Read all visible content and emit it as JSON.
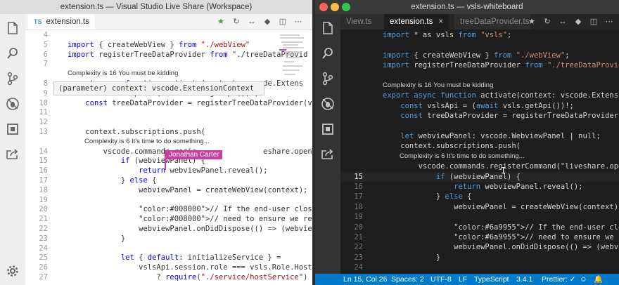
{
  "left": {
    "title": "extension.ts — Visual Studio Live Share (Workspace)",
    "tab": {
      "badge": "TS",
      "label": "extension.ts"
    },
    "hover_text": "(parameter) context: vscode.ExtensionContext",
    "participant": "Jonathan Carter",
    "lines": [
      {
        "n": "4",
        "t": ""
      },
      {
        "n": "5",
        "t": "import { createWebView } from \"./webView\""
      },
      {
        "n": "6",
        "t": "import registerTreeDataProvider from \"./treeDataProvid"
      },
      {
        "n": "7",
        "t": ""
      },
      {
        "n": "",
        "t": "Complexity is 16 You must be kidding",
        "lens": true
      },
      {
        "n": "8",
        "t": "export async function activate(context: vscode.Extens"
      },
      {
        "n": "9",
        "t": "    const vslsApi = (await vsls.getApi())!;"
      },
      {
        "n": "10",
        "t": "    const treeDataProvider = registerTreeDataProvider(v"
      },
      {
        "n": "11",
        "t": ""
      },
      {
        "n": "12",
        "t": ""
      },
      {
        "n": "13",
        "t": "    context.subscriptions.push("
      },
      {
        "n": "",
        "t": "Complexity is 6 It's time to do something...",
        "lens": true,
        "indent": true
      },
      {
        "n": "14",
        "t": "        vscode.commands.regis               eshare.openWhi"
      },
      {
        "n": "15",
        "t": "            if (webviewPanel) {"
      },
      {
        "n": "16",
        "t": "                return webviewPanel.reveal();"
      },
      {
        "n": "17",
        "t": "            } else {"
      },
      {
        "n": "18",
        "t": "                webviewPanel = createWebView(context);"
      },
      {
        "n": "19",
        "t": ""
      },
      {
        "n": "20",
        "t": "                // If the end-user closes the whiteboard, ther"
      },
      {
        "n": "21",
        "t": "                // need to ensure we re-created it on the next"
      },
      {
        "n": "22",
        "t": "                webviewPanel.onDidDispose(() => (webviewPanel"
      },
      {
        "n": "23",
        "t": "            }"
      },
      {
        "n": "24",
        "t": ""
      },
      {
        "n": "25",
        "t": "            let { default: initializeService } ="
      },
      {
        "n": "26",
        "t": "                vslsApi.session.role === vsls.Role.Host"
      },
      {
        "n": "27",
        "t": "                    ? require(\"./service/hostService\")"
      }
    ]
  },
  "right": {
    "title": "extension.ts — vsls-whiteboard",
    "tabs": [
      {
        "label": "View.ts",
        "active": false
      },
      {
        "label": "extension.ts",
        "active": true
      },
      {
        "label": "treeDataProvider.ts",
        "active": false
      }
    ],
    "lines": [
      {
        "n": "",
        "t": "import * as vsls from \"vsls\";"
      },
      {
        "n": "",
        "t": ""
      },
      {
        "n": "",
        "t": "import { createWebView } from \"./webView\";"
      },
      {
        "n": "",
        "t": "import registerTreeDataProvider from \"./treeDataProvider\""
      },
      {
        "n": "",
        "t": ""
      },
      {
        "n": "",
        "t": "Complexity is 16 You must be kidding",
        "lens": true
      },
      {
        "n": "",
        "t": "export async function activate(context: vscode.ExtensionCo"
      },
      {
        "n": "",
        "t": "    const vslsApi = (await vsls.getApi())!;"
      },
      {
        "n": "",
        "t": "    const treeDataProvider = registerTreeDataProvider(vslsApi"
      },
      {
        "n": "",
        "t": ""
      },
      {
        "n": "",
        "t": "    let webviewPanel: vscode.WebviewPanel | null;"
      },
      {
        "n": "",
        "t": "    context.subscriptions.push("
      },
      {
        "n": "",
        "t": "Complexity is 6 It's time to do something...",
        "lens": true,
        "indent": true
      },
      {
        "n": "",
        "t": "        vscode.commands.registerCommand(\"liveshare.openWhiteboa"
      },
      {
        "n": "15",
        "t": "            if (webviewPanel) {",
        "cur": true
      },
      {
        "n": "16",
        "t": "                return webviewPanel.reveal();"
      },
      {
        "n": "17",
        "t": "            } else {"
      },
      {
        "n": "18",
        "t": "                webviewPanel = createWebView(context);"
      },
      {
        "n": "19",
        "t": ""
      },
      {
        "n": "20",
        "t": "                // If the end-user closes the whiteboard, then we"
      },
      {
        "n": "21",
        "t": "                // need to ensure we re-created it on the next clic"
      },
      {
        "n": "22",
        "t": "                webviewPanel.onDidDispose(() => (webviewPanel = nul"
      },
      {
        "n": "23",
        "t": "            }"
      },
      {
        "n": "24",
        "t": ""
      },
      {
        "n": "25",
        "t": "            let { default: initializeService } ="
      }
    ],
    "status": {
      "position": "Ln 15, Col 26",
      "spaces": "Spaces: 2",
      "encoding": "UTF-8",
      "eol": "LF",
      "language": "TypeScript",
      "version": "3.4.1",
      "prettier": "Prettier: ✓"
    }
  },
  "colors": {
    "left_bg": "#ffffff",
    "right_bg": "#1e1e1e",
    "status_bar": "#007acc",
    "participant_flag": "#c93f9b"
  },
  "icons": [
    "files-icon",
    "search-icon",
    "source-control-icon",
    "debug-icon",
    "extensions-icon",
    "live-share-icon",
    "gear-icon"
  ]
}
